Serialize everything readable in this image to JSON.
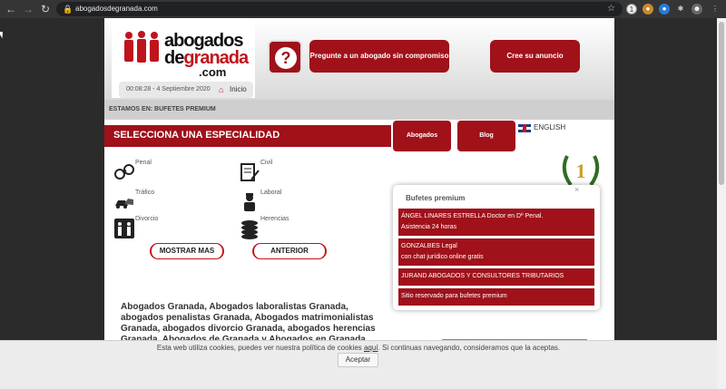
{
  "browser": {
    "url": "abogadosdegranada.com",
    "back_icon": "back-arrow-icon",
    "forward_icon": "forward-arrow-icon",
    "reload_icon": "reload-icon"
  },
  "header": {
    "logo_line1": "abogados",
    "logo_line2_a": "de",
    "logo_line2_b": "granada",
    "logo_line3": ".com",
    "datetime": "00:08:28 - 4 Septiembre 2020",
    "home_label": "Inicio",
    "question_mark": "?",
    "ask_button": "Pregunte a un abogado sin compromiso",
    "create_ad_button": "Cree su anuncio"
  },
  "breadcrumb": "ESTAMOS EN: BUFETES PREMIUM",
  "specialties": {
    "title": "SELECCIONA UNA ESPECIALIDAD",
    "items": [
      {
        "label": "Penal",
        "icon": "handcuffs-icon"
      },
      {
        "label": "Civil",
        "icon": "document-sign-icon"
      },
      {
        "label": "Tráfico",
        "icon": "car-crash-icon"
      },
      {
        "label": "Laboral",
        "icon": "worker-icon"
      },
      {
        "label": "Divorcio",
        "icon": "separation-icon"
      },
      {
        "label": "Herencias",
        "icon": "coins-icon"
      }
    ],
    "show_more": "MOSTRAR MAS",
    "previous": "ANTERIOR"
  },
  "tabs": {
    "abogados": "Abogados",
    "blog": "Blog",
    "english": "ENGLISH"
  },
  "premium": {
    "title": "Bufetes premium",
    "close": "×",
    "items": [
      {
        "line1": "ÁNGEL LINARES ESTRELLA Doctor en Dº Penal.",
        "line2": "Asistencia 24 horas"
      },
      {
        "line1": "GONZALBES Legal",
        "line2": "con chat jurídico online gratis"
      },
      {
        "line1": "JURAND ABOGADOS Y CONSULTORES TRIBUTARIOS",
        "line2": ""
      },
      {
        "line1": "Sitio reservado para bufetes premium",
        "line2": ""
      }
    ]
  },
  "seo_text": "Abogados Granada, Abogados laboralistas Granada, abogados penalistas Granada, Abogados matrimonialistas Granada, abogados divorcio Granada, abogados herencias Granada, Abogados de Granada y Abogados en Granada.",
  "cookie": {
    "text_before": "Esta web utiliza cookies, puedes ver nuestra política de cookies ",
    "link": "aquí",
    "text_after": ". Si continuas navegando, consideramos que la aceptas.",
    "accept": "Aceptar"
  },
  "colors": {
    "brand_red": "#a0111a",
    "chrome_dark": "#353535",
    "page_bg": "#ffffff"
  }
}
